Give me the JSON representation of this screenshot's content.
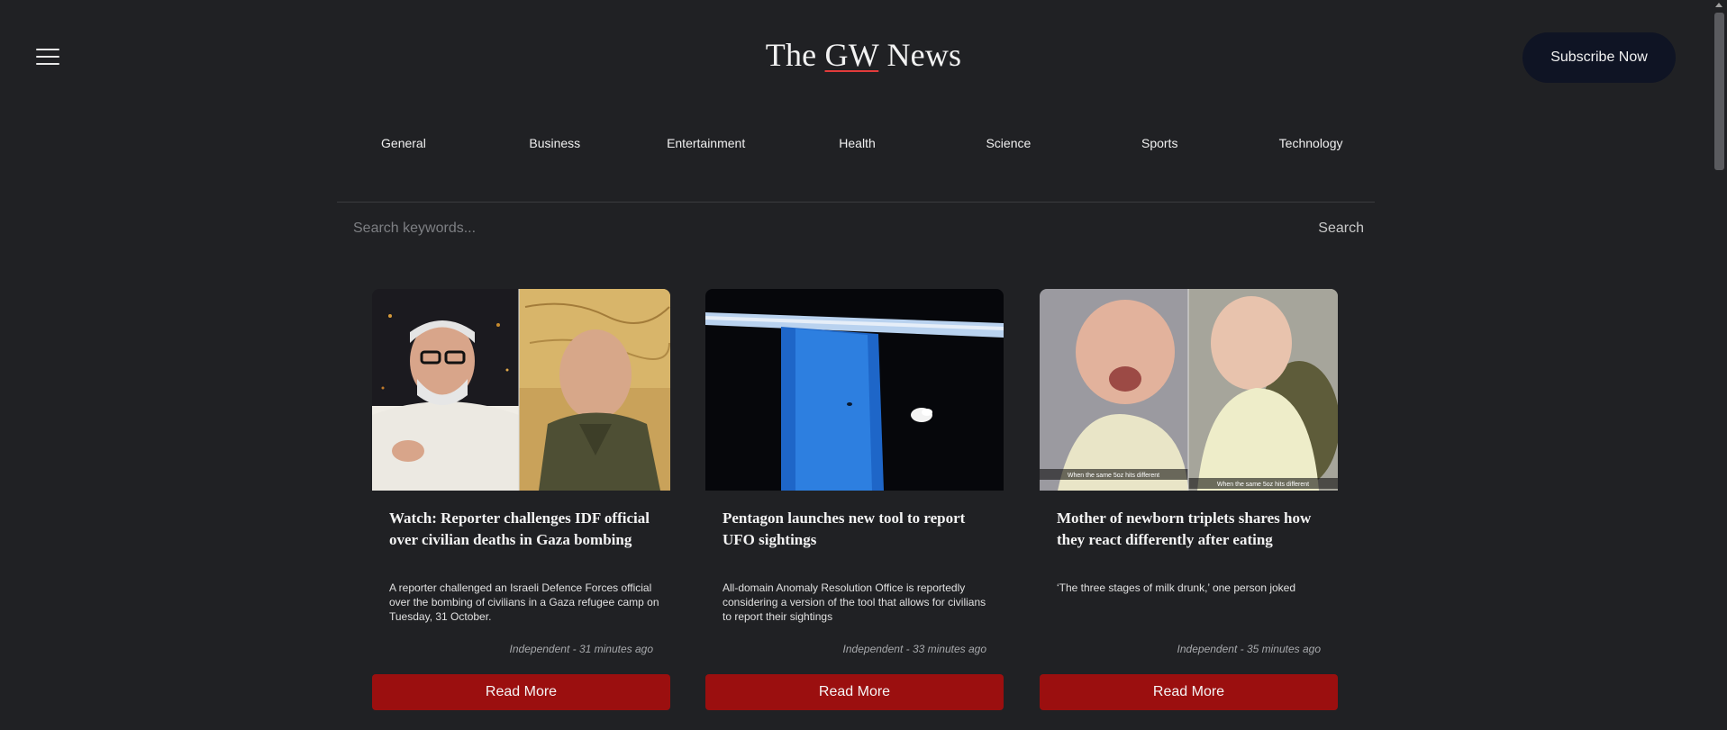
{
  "header": {
    "title_pre": "The ",
    "title_gw": "GW",
    "title_post": " News",
    "subscribe_label": "Subscribe Now",
    "menu_icon": "hamburger-menu-icon"
  },
  "categories": [
    "General",
    "Business",
    "Entertainment",
    "Health",
    "Science",
    "Sports",
    "Technology"
  ],
  "search": {
    "placeholder": "Search keywords...",
    "button_label": "Search"
  },
  "articles": [
    {
      "title": "Watch: Reporter challenges IDF official over civilian deaths in Gaza bombing",
      "description": "A reporter challenged an Israeli Defence Forces official over the bombing of civilians in a Gaza refugee camp on Tuesday, 31 October.",
      "source": "Independent - 31 minutes ago",
      "button_label": "Read More"
    },
    {
      "title": "Pentagon launches new tool to report UFO sightings",
      "description": "All-domain Anomaly Resolution Office is reportedly considering a version of the tool that allows for civilians to report their sightings",
      "source": "Independent - 33 minutes ago",
      "button_label": "Read More"
    },
    {
      "title": "Mother of newborn triplets shares how they react differently after eating",
      "description": "‘The three stages of milk drunk,’ one person joked",
      "source": "Independent - 35 minutes ago",
      "button_label": "Read More",
      "image_captions": [
        "When the same 5oz hits different",
        "When the same 5oz hits different"
      ]
    }
  ],
  "colors": {
    "background": "#202124",
    "subscribe_bg": "#0f1424",
    "accent_red": "#9b0f0f",
    "underline_red": "#e23b3b"
  }
}
